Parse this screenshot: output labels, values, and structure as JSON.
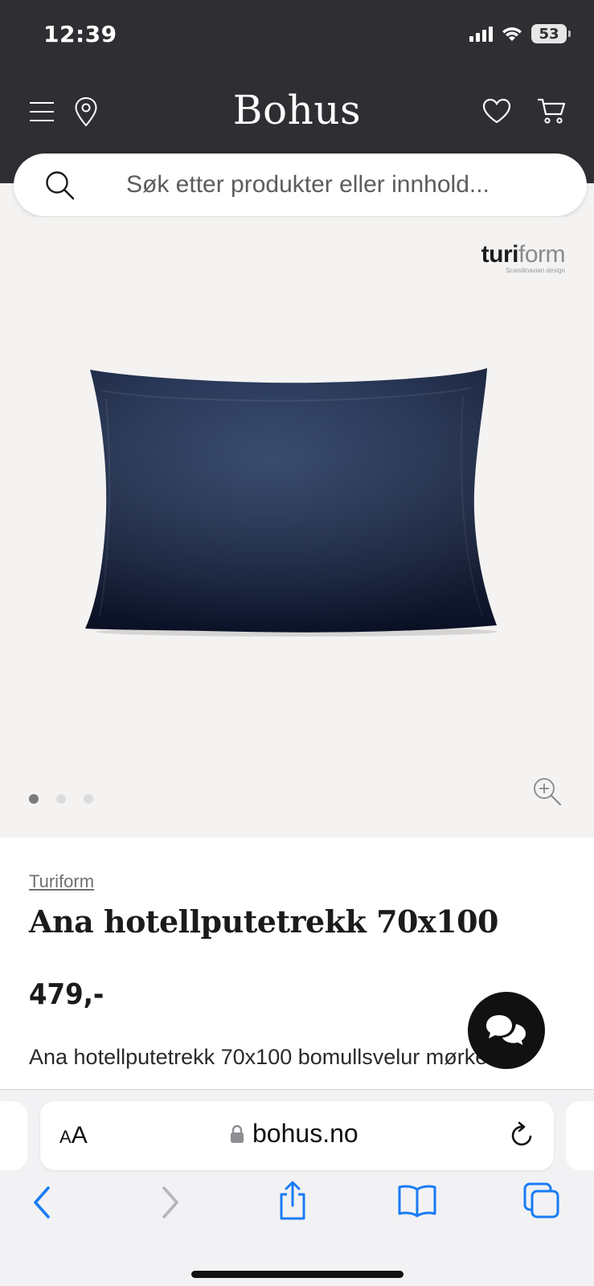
{
  "status_bar": {
    "time": "12:39",
    "battery": "53"
  },
  "header": {
    "logo": "Bohus",
    "menu_icon": "menu-icon",
    "location_icon": "location-pin-icon",
    "wishlist_icon": "heart-icon",
    "cart_icon": "cart-icon"
  },
  "search": {
    "placeholder": "Søk etter produkter eller innhold..."
  },
  "gallery": {
    "brand_logo_bold": "turi",
    "brand_logo_light": "form",
    "brand_logo_sub": "Scandinavian design",
    "image_count": 3,
    "active_index": 0,
    "product_color": "#1b2a4a"
  },
  "product": {
    "brand": "Turiform",
    "title": "Ana hotellputetrekk 70x100",
    "price": "479,-",
    "description": "Ana hotellputetrekk 70x100 bomullsvelur mørkeblå"
  },
  "browser": {
    "text_size_label_big": "A",
    "text_size_label_small": "A",
    "url": "bohus.no",
    "buttons": [
      "back-icon",
      "forward-icon",
      "share-icon",
      "bookmarks-icon",
      "tabs-icon"
    ]
  },
  "colors": {
    "header_bg": "#2f2f33",
    "ios_blue": "#1a7cf5",
    "chat_bg": "#111111"
  }
}
